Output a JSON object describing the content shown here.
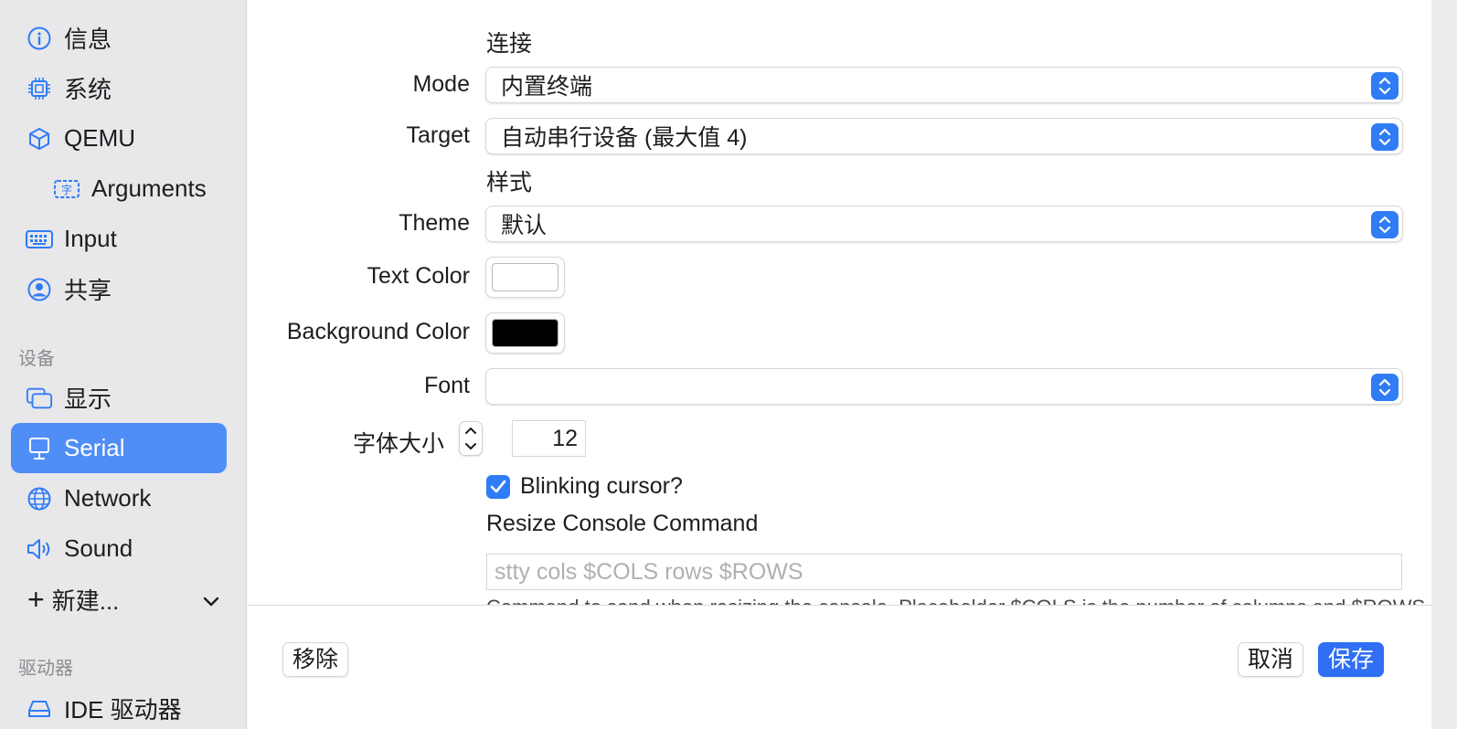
{
  "sidebar": {
    "items": [
      {
        "label": "信息",
        "icon": "info-icon"
      },
      {
        "label": "系统",
        "icon": "chip-icon"
      },
      {
        "label": "QEMU",
        "icon": "cube-icon"
      },
      {
        "label": "Arguments",
        "icon": "arguments-icon"
      },
      {
        "label": "Input",
        "icon": "keyboard-icon"
      },
      {
        "label": "共享",
        "icon": "person-circle-icon"
      }
    ],
    "devices_section": "设备",
    "devices": [
      {
        "label": "显示",
        "icon": "display-icon"
      },
      {
        "label": "Serial",
        "icon": "serial-icon"
      },
      {
        "label": "Network",
        "icon": "globe-icon"
      },
      {
        "label": "Sound",
        "icon": "speaker-icon"
      }
    ],
    "new_label": "新建...",
    "drives_section": "驱动器",
    "drives": [
      {
        "label": "IDE 驱动器",
        "icon": "drive-icon"
      }
    ]
  },
  "form": {
    "connection_title": "连接",
    "mode_label": "Mode",
    "mode_value": "内置终端",
    "target_label": "Target",
    "target_value": "自动串行设备 (最大值 4)",
    "style_title": "样式",
    "theme_label": "Theme",
    "theme_value": "默认",
    "text_color_label": "Text Color",
    "text_color": "#ffffff",
    "bg_color_label": "Background Color",
    "bg_color": "#000000",
    "font_label": "Font",
    "font_value": "",
    "font_size_label": "字体大小",
    "font_size_value": "12",
    "blink_label": "Blinking cursor?",
    "resize_title": "Resize Console Command",
    "resize_placeholder": "stty cols $COLS rows $ROWS",
    "resize_help": "Command to send when resizing the console. Placeholder $COLS is the number of columns and $ROWS"
  },
  "footer": {
    "remove_label": "移除",
    "cancel_label": "取消",
    "save_label": "保存"
  },
  "colors": {
    "accent": "#2f7cf6",
    "selected_bg": "#4f8ef7",
    "sidebar_bg": "#e8e7ea"
  }
}
